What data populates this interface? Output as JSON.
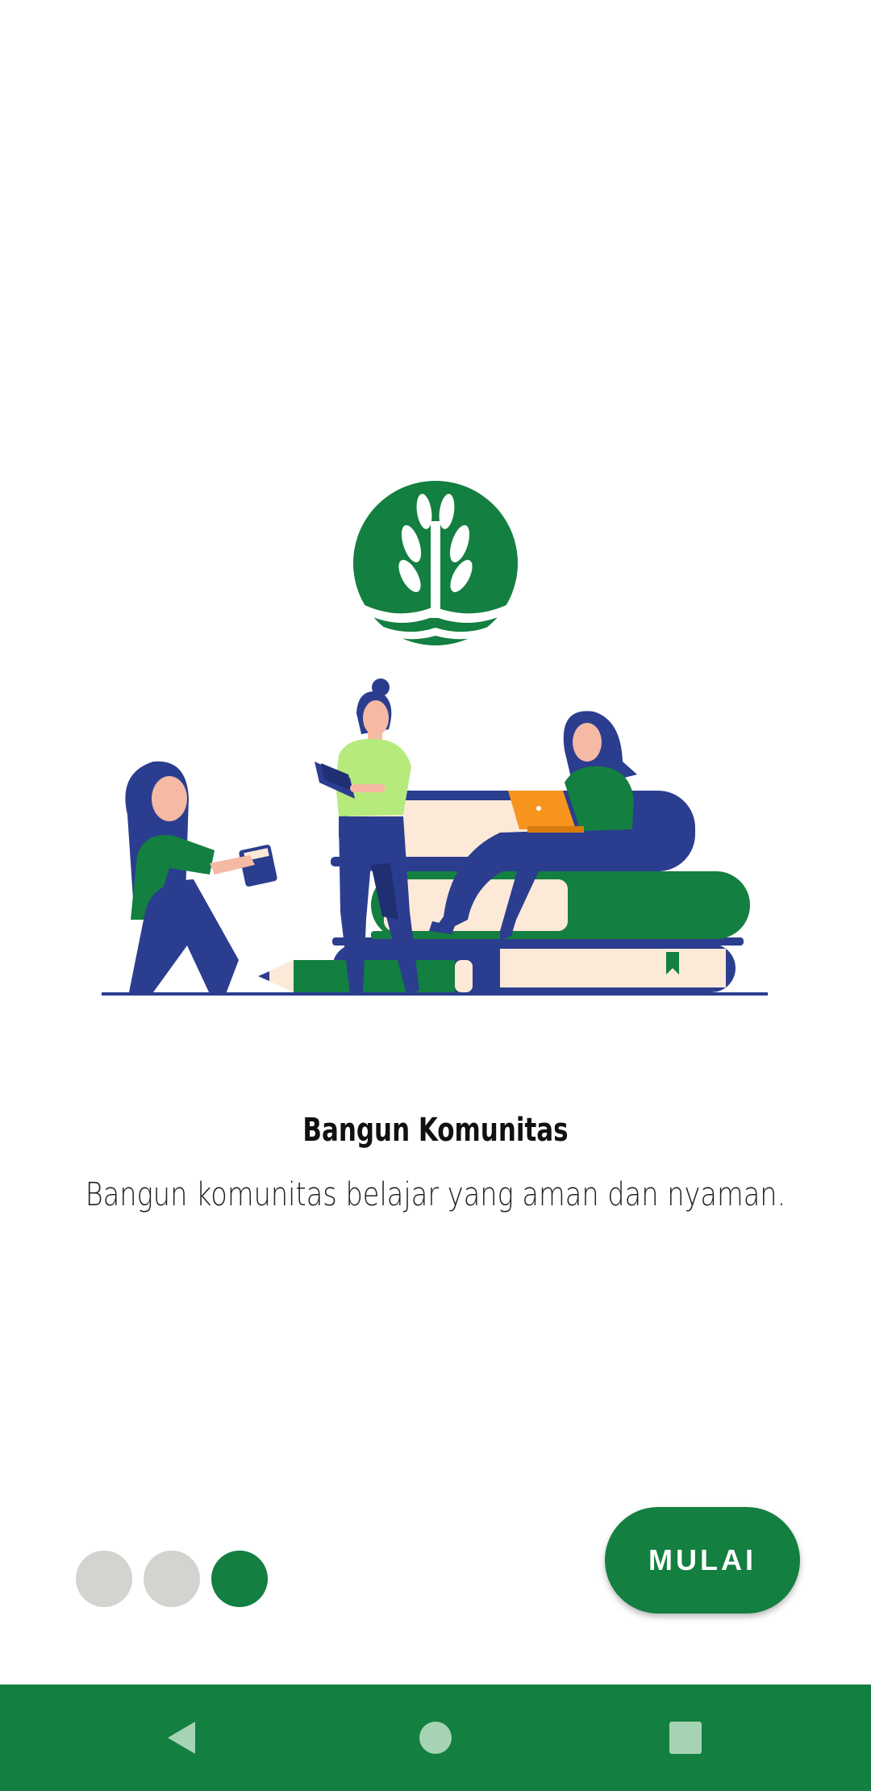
{
  "onboarding": {
    "title": "Bangun Komunitas",
    "description": "Bangun komunitas belajar yang aman dan nyaman.",
    "start_label": "MULAI",
    "page_indicator": {
      "total": 3,
      "current": 3
    }
  },
  "icons": {
    "logo": "wheat-plant-logo",
    "illustration": "people-studying-on-books-illustration",
    "nav_back": "back-triangle-icon",
    "nav_home": "home-circle-icon",
    "nav_recent": "recent-apps-square-icon"
  },
  "colors": {
    "primary": "#137f40",
    "navy": "#2b3d8f",
    "cream": "#fde9d7",
    "light_green": "#b6ea7d",
    "orange": "#f7941e",
    "indicator_inactive": "#d3d3d0",
    "nav_icon": "#a7d3b5"
  }
}
